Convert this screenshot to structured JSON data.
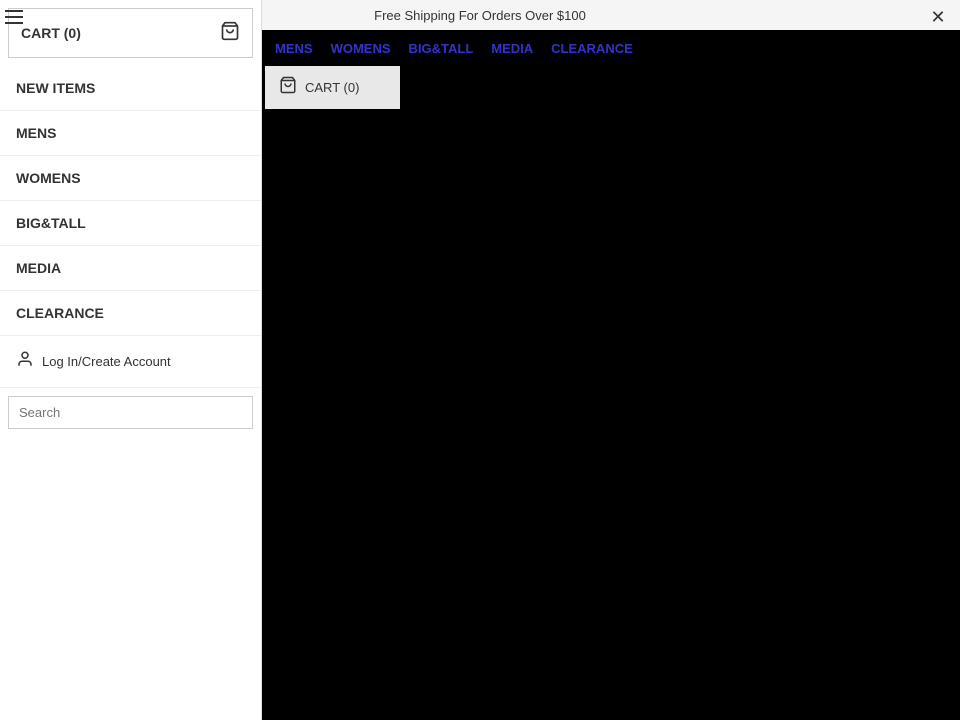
{
  "announcement": {
    "text": "Free Shipping For Orders Over $100"
  },
  "header": {
    "hamburger_label": "menu",
    "close_label": "✕",
    "cart_label": "CART (0)",
    "cart_count": "0"
  },
  "top_nav": {
    "items": [
      {
        "label": "MENS",
        "href": "#"
      },
      {
        "label": "WOMENS",
        "href": "#"
      },
      {
        "label": "BIG&TALL",
        "href": "#"
      },
      {
        "label": "MEDIA",
        "href": "#"
      },
      {
        "label": "CLEARANCE",
        "href": "#"
      }
    ]
  },
  "sidebar": {
    "cart_label": "CART (0)",
    "nav_items": [
      {
        "label": "NEW ITEMS"
      },
      {
        "label": "MENS"
      },
      {
        "label": "WOMENS"
      },
      {
        "label": "BIG&TALL"
      },
      {
        "label": "MEDIA"
      },
      {
        "label": "CLEARANCE"
      }
    ],
    "login_label": "Log In/Create Account",
    "search_placeholder": "Search"
  },
  "cart_dropdown": {
    "label": "CART (0)"
  }
}
